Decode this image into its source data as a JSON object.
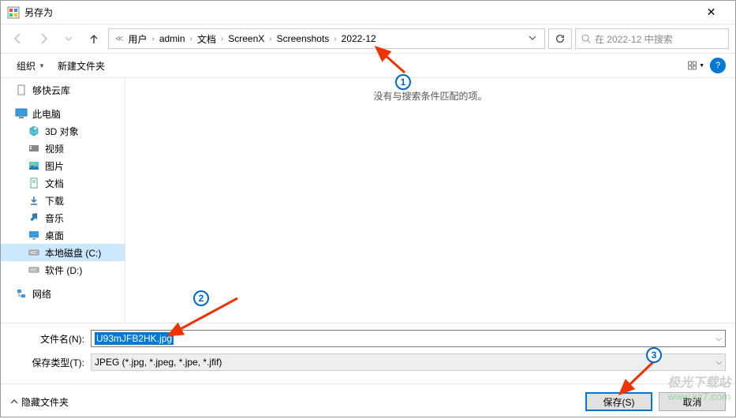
{
  "window": {
    "title": "另存为",
    "close": "✕"
  },
  "breadcrumb": {
    "items": [
      "用户",
      "admin",
      "文档",
      "ScreenX",
      "Screenshots",
      "2022-12"
    ]
  },
  "search": {
    "placeholder": "在 2022-12 中搜索"
  },
  "toolbar": {
    "organize": "组织",
    "newfolder": "新建文件夹"
  },
  "sidebar": {
    "quick": {
      "label": "够快云库"
    },
    "pc": {
      "label": "此电脑"
    },
    "pc_children": [
      {
        "label": "3D 对象"
      },
      {
        "label": "视频"
      },
      {
        "label": "图片"
      },
      {
        "label": "文档"
      },
      {
        "label": "下载"
      },
      {
        "label": "音乐"
      },
      {
        "label": "桌面"
      },
      {
        "label": "本地磁盘 (C:)"
      },
      {
        "label": "软件 (D:)"
      }
    ],
    "network": {
      "label": "网络"
    }
  },
  "content": {
    "empty": "没有与搜索条件匹配的项。"
  },
  "form": {
    "filename_label": "文件名(N):",
    "filename_value": "U93mJFB2HK.jpg",
    "filetype_label": "保存类型(T):",
    "filetype_value": "JPEG (*.jpg, *.jpeg, *.jpe, *.jfif)"
  },
  "footer": {
    "hide": "隐藏文件夹",
    "save": "保存(S)",
    "cancel": "取消"
  },
  "annotations": {
    "a1": "1",
    "a2": "2",
    "a3": "3"
  },
  "watermark": {
    "line1": "极光下载站",
    "line2": "www.xz7.com"
  }
}
